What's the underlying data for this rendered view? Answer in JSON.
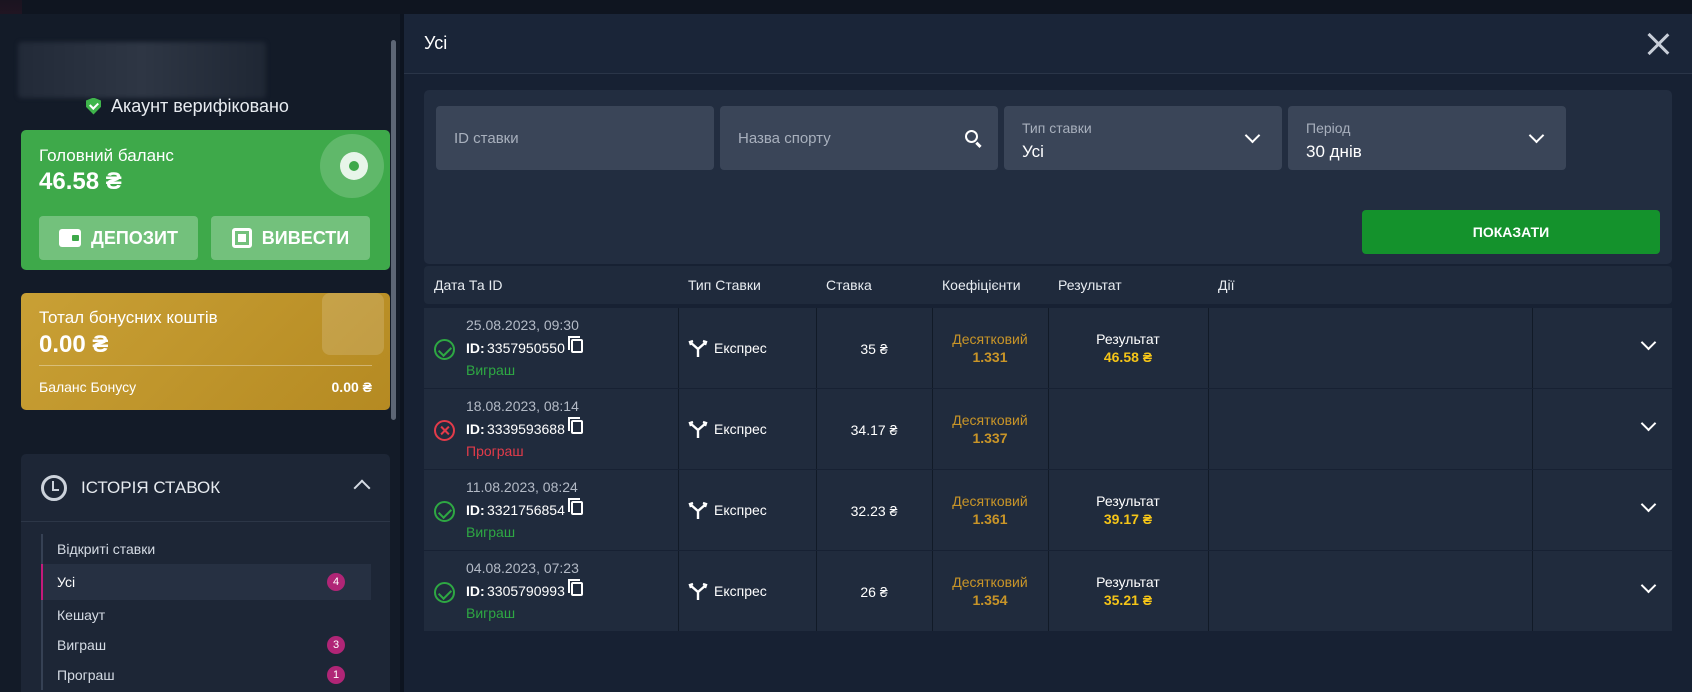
{
  "account": {
    "verified_text": "Акаунт верифіковано"
  },
  "balance": {
    "title": "Головний баланс",
    "value": "46.58 ₴",
    "deposit_label": "ДЕПОЗИТ",
    "withdraw_label": "ВИВЕСТИ"
  },
  "bonus": {
    "title": "Тотал бонусних коштів",
    "value": "0.00 ₴",
    "sub_label": "Баланс Бонусу",
    "sub_value": "0.00 ₴"
  },
  "history": {
    "title": "ІСТОРІЯ СТАВОК",
    "items": [
      {
        "label": "Відкриті ставки",
        "count": ""
      },
      {
        "label": "Усі",
        "count": "4"
      },
      {
        "label": "Кешаут",
        "count": ""
      },
      {
        "label": "Виграш",
        "count": "3"
      },
      {
        "label": "Програш",
        "count": "1"
      }
    ]
  },
  "modal": {
    "title": "Усі"
  },
  "filters": {
    "bet_id_placeholder": "ID ставки",
    "sport_placeholder": "Назва спорту",
    "bet_type_label": "Тип ставки",
    "bet_type_value": "Усі",
    "period_label": "Період",
    "period_value": "30 днів",
    "show_button": "ПОКАЗАТИ"
  },
  "table": {
    "headers": [
      "Дата Та ID",
      "Тип Ставки",
      "Ставка",
      "Коефіцієнти",
      "Результат",
      "Дії"
    ],
    "rows": [
      {
        "date": "25.08.2023, 09:30",
        "id_label": "ID:",
        "id": "3357950550",
        "outcome": "Виграш",
        "status": "win",
        "type": "Експрес",
        "stake": "35 ₴",
        "odds_type": "Десятковий",
        "odds": "1.331",
        "result_label": "Результат",
        "result": "46.58 ₴"
      },
      {
        "date": "18.08.2023, 08:14",
        "id_label": "ID:",
        "id": "3339593688",
        "outcome": "Програш",
        "status": "lost",
        "type": "Експрес",
        "stake": "34.17 ₴",
        "odds_type": "Десятковий",
        "odds": "1.337",
        "result_label": "",
        "result": ""
      },
      {
        "date": "11.08.2023, 08:24",
        "id_label": "ID:",
        "id": "3321756854",
        "outcome": "Виграш",
        "status": "win",
        "type": "Експрес",
        "stake": "32.23 ₴",
        "odds_type": "Десятковий",
        "odds": "1.361",
        "result_label": "Результат",
        "result": "39.17 ₴"
      },
      {
        "date": "04.08.2023, 07:23",
        "id_label": "ID:",
        "id": "3305790993",
        "outcome": "Виграш",
        "status": "win",
        "type": "Експрес",
        "stake": "26 ₴",
        "odds_type": "Десятковий",
        "odds": "1.354",
        "result_label": "Результат",
        "result": "35.21 ₴"
      }
    ]
  },
  "colors": {
    "balance_green": "#3ea94a",
    "bonus_gold": "#c9a035",
    "show_button_green": "#14922c",
    "win": "#2ea843",
    "lost": "#e23b4a",
    "odds": "#c99528",
    "result": "#f5c518",
    "badge": "#b02576"
  }
}
